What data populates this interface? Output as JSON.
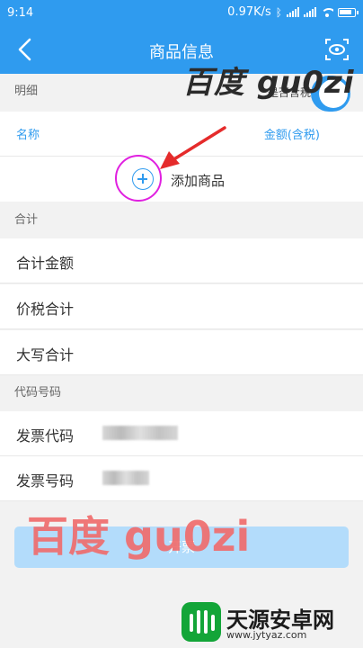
{
  "status_bar": {
    "time": "9:14",
    "speed": "0.97K/s"
  },
  "header": {
    "title": "商品信息"
  },
  "details": {
    "section_label": "明细",
    "tax_toggle_label": "是否含税",
    "tax_toggle_on": true
  },
  "columns": {
    "name": "名称",
    "amount": "金额(含税)"
  },
  "add_item": {
    "label": "添加商品"
  },
  "totals": {
    "section_label": "合计",
    "rows": [
      "合计金额",
      "价税合计",
      "大写合计"
    ]
  },
  "codes": {
    "section_label": "代码号码",
    "invoice_code_label": "发票代码",
    "invoice_number_label": "发票号码"
  },
  "submit": {
    "label": "开票"
  },
  "watermark": {
    "top": "百度 gu0zi",
    "bottom": "百度 gu0zi"
  },
  "logo": {
    "name": "天源安卓网",
    "url": "www.jytyaz.com"
  },
  "colors": {
    "primary": "#2f9bef",
    "highlight_circle": "#e020e0",
    "arrow": "#e52b2b",
    "submit_bg": "#b3dcfb"
  }
}
